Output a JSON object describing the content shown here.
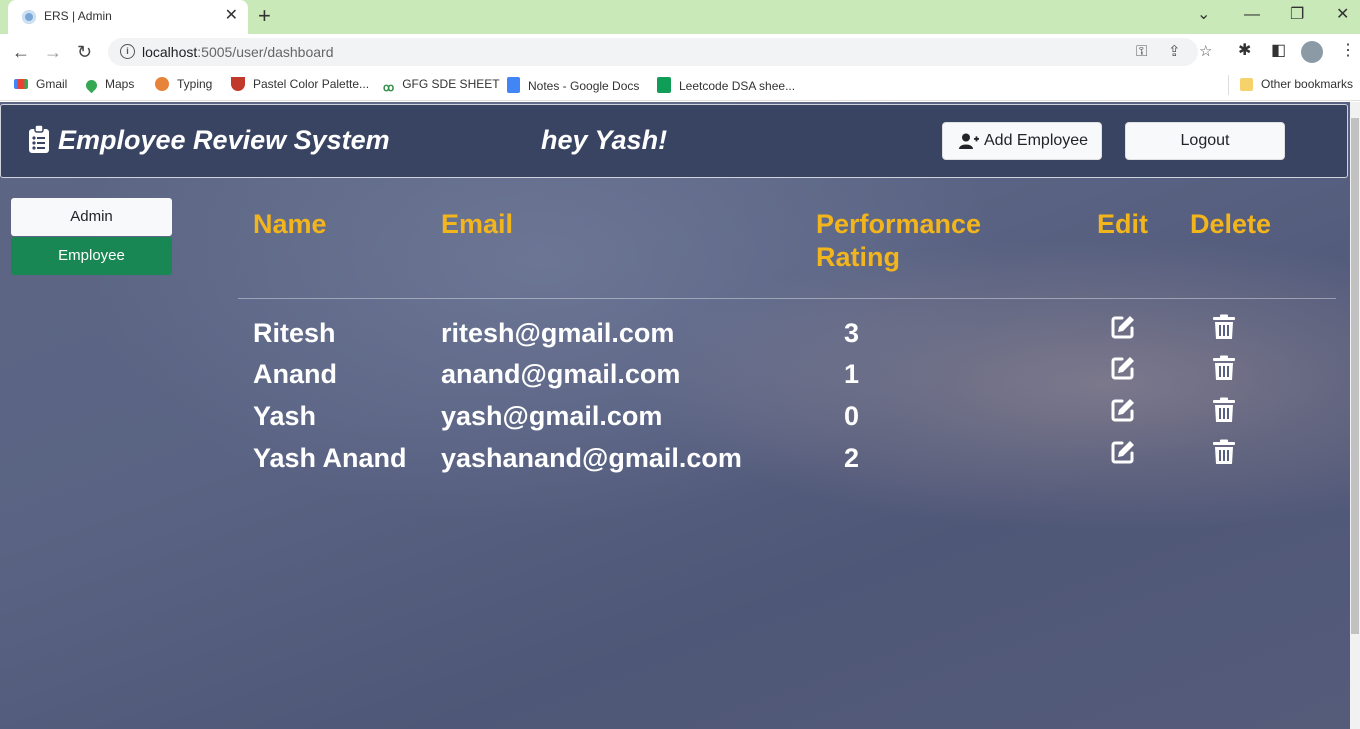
{
  "browser": {
    "tab_title": "ERS | Admin",
    "url_host": "localhost",
    "url_rest": ":5005/user/dashboard",
    "bookmarks": [
      {
        "label": "Gmail",
        "icon": "gmail-icon"
      },
      {
        "label": "Maps",
        "icon": "maps-icon"
      },
      {
        "label": "Typing",
        "icon": "typing-icon"
      },
      {
        "label": "Pastel Color Palette...",
        "icon": "palette-icon"
      },
      {
        "label": "GFG SDE SHEET",
        "icon": "gfg-icon"
      },
      {
        "label": "Notes - Google Docs",
        "icon": "docs-icon"
      },
      {
        "label": "Leetcode DSA shee...",
        "icon": "sheets-icon"
      }
    ],
    "other_bookmarks": "Other bookmarks"
  },
  "header": {
    "brand": "Employee Review System",
    "greeting": "hey Yash!",
    "add_employee_label": "Add Employee",
    "logout_label": "Logout"
  },
  "sidebar": {
    "admin_label": "Admin",
    "employee_label": "Employee"
  },
  "table": {
    "headers": {
      "name": "Name",
      "email": "Email",
      "rating_line1": "Performance",
      "rating_line2": "Rating",
      "edit": "Edit",
      "delete": "Delete"
    },
    "rows": [
      {
        "name": "Ritesh",
        "email": "ritesh@gmail.com",
        "rating": "3"
      },
      {
        "name": "Anand",
        "email": "anand@gmail.com",
        "rating": "1"
      },
      {
        "name": "Yash",
        "email": "yash@gmail.com",
        "rating": "0"
      },
      {
        "name": "Yash Anand",
        "email": "yashanand@gmail.com",
        "rating": "2"
      }
    ]
  },
  "colors": {
    "navbar": "#394362",
    "header_text": "#f3b51c",
    "employee_button": "#198754"
  }
}
